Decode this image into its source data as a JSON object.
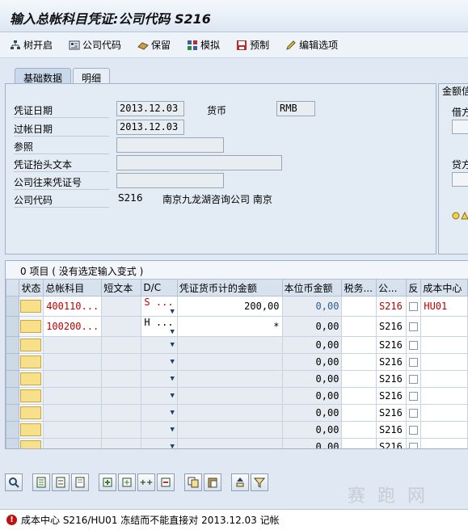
{
  "window": {
    "title": "输入总帐科目凭证:公司代码 S216"
  },
  "toolbar": [
    {
      "label": "树开启",
      "icon": "tree-icon"
    },
    {
      "label": "公司代码",
      "icon": "company-code-icon"
    },
    {
      "label": "保留",
      "icon": "hold-icon"
    },
    {
      "label": "模拟",
      "icon": "simulate-icon"
    },
    {
      "label": "预制",
      "icon": "park-icon"
    },
    {
      "label": "编辑选项",
      "icon": "pencil-icon"
    }
  ],
  "tabs": [
    {
      "label": "基础数据",
      "active": true
    },
    {
      "label": "明细",
      "active": false
    }
  ],
  "header": {
    "doc_date_label": "凭证日期",
    "doc_date": "2013.12.03",
    "currency_label": "货币",
    "currency": "RMB",
    "posting_date_label": "过帐日期",
    "posting_date": "2013.12.03",
    "reference_label": "参照",
    "reference": "",
    "header_text_label": "凭证抬头文本",
    "header_text": "",
    "intercompany_label": "公司往来凭证号",
    "intercompany": "",
    "company_code_label": "公司代码",
    "company_code": "S216",
    "company_name": "南京九龙湖咨询公司 南京"
  },
  "side_group": {
    "title": "金额信",
    "debit_label": "借方",
    "credit_label": "贷方"
  },
  "table": {
    "caption": "0 项目 ( 没有选定输入变式 )",
    "columns": [
      "状态",
      "总帐科目",
      "短文本",
      "D/C",
      "凭证货币计的金额",
      "本位币金额",
      "税务...",
      "公...",
      "反",
      "成本中心"
    ],
    "rows": [
      {
        "gl": "400110...",
        "text": "",
        "dc": "S ...",
        "amount": "200,00",
        "local": "0,00",
        "tax": "",
        "cc": "S216",
        "cost_center": "HU01"
      },
      {
        "gl": "100200...",
        "text": "",
        "dc": "H ...",
        "amount": "*",
        "local": "0,00",
        "tax": "",
        "cc": "S216",
        "cost_center": ""
      },
      {
        "gl": "",
        "text": "",
        "dc": "",
        "amount": "",
        "local": "0,00",
        "tax": "",
        "cc": "S216",
        "cost_center": ""
      },
      {
        "gl": "",
        "text": "",
        "dc": "",
        "amount": "",
        "local": "0,00",
        "tax": "",
        "cc": "S216",
        "cost_center": ""
      },
      {
        "gl": "",
        "text": "",
        "dc": "",
        "amount": "",
        "local": "0,00",
        "tax": "",
        "cc": "S216",
        "cost_center": ""
      },
      {
        "gl": "",
        "text": "",
        "dc": "",
        "amount": "",
        "local": "0,00",
        "tax": "",
        "cc": "S216",
        "cost_center": ""
      },
      {
        "gl": "",
        "text": "",
        "dc": "",
        "amount": "",
        "local": "0,00",
        "tax": "",
        "cc": "S216",
        "cost_center": ""
      },
      {
        "gl": "",
        "text": "",
        "dc": "",
        "amount": "",
        "local": "0,00",
        "tax": "",
        "cc": "S216",
        "cost_center": ""
      },
      {
        "gl": "",
        "text": "",
        "dc": "",
        "amount": "",
        "local": "0,00",
        "tax": "",
        "cc": "S216",
        "cost_center": ""
      }
    ]
  },
  "bottom_toolbar": {
    "add_label": "++"
  },
  "watermark": "赛 跑 网",
  "status": {
    "icon": "error-icon",
    "message": "成本中心 S216/HU01 冻结而不能直接对 2013.12.03 记帐"
  }
}
